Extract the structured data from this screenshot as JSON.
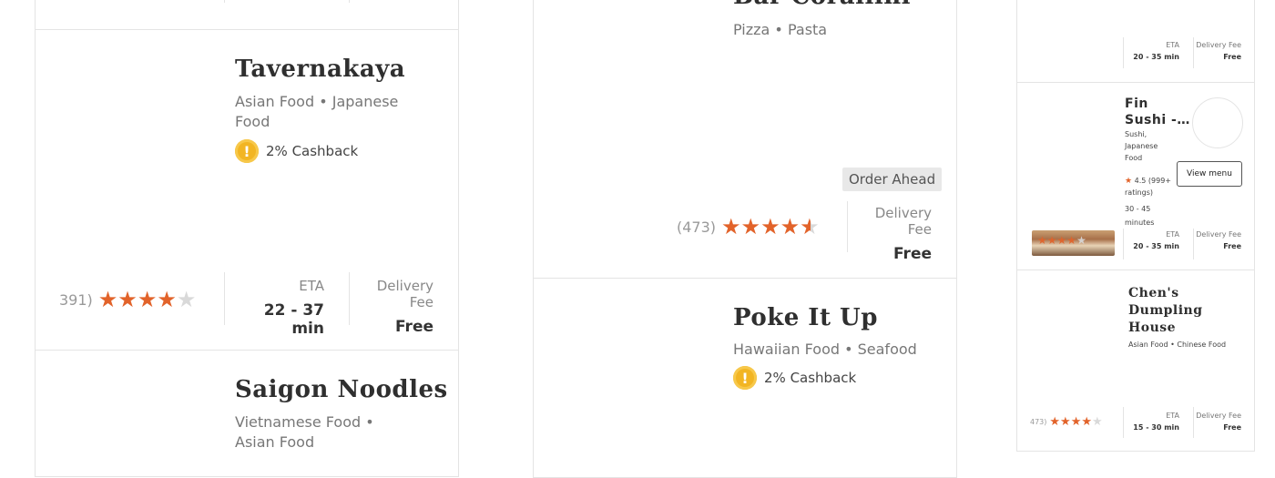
{
  "left_column": {
    "top_card": {},
    "tavernakaya": {
      "name": "Tavernakaya",
      "cuisine": "Asian Food • Japanese Food",
      "cashback": "2% Cashback",
      "coin_glyph": "!",
      "rating_count": "391)",
      "stars": 4,
      "eta_label": "ETA",
      "eta_value": "22 - 37 min",
      "fee_label": "Delivery Fee",
      "fee_value": "Free"
    },
    "saigon": {
      "name": "Saigon Noodles",
      "cuisine": "Vietnamese Food • Asian Food"
    }
  },
  "middle_column": {
    "bar": {
      "name": "Bar Corallini",
      "cuisine": "Pizza • Pasta",
      "badge": "Order Ahead",
      "rating_count": "(473)",
      "stars": 4.5,
      "fee_label": "Delivery Fee",
      "fee_value": "Free"
    },
    "poke": {
      "name": "Poke It Up",
      "cuisine": "Hawaiian Food • Seafood",
      "cashback": "2% Cashback",
      "coin_glyph": "!"
    }
  },
  "right_column": {
    "top_card": {
      "eta_label": "ETA",
      "eta_value": "20 - 35 min",
      "fee_label": "Delivery Fee",
      "fee_value": "Free"
    },
    "fin_sushi": {
      "name_line1": "Fin",
      "name_line2": "Sushi -…",
      "cuisine_line1": "Sushi,",
      "cuisine_line2": "Japanese",
      "cuisine_line3": "Food",
      "rating_line1": "4.5 (999+",
      "rating_line2": "ratings)",
      "time_line1": "30 - 45",
      "time_line2": "minutes",
      "view_menu": "View menu",
      "eta_label": "ETA",
      "eta_value": "20 - 35 min",
      "fee_label": "Delivery Fee",
      "fee_value": "Free",
      "star_glyph": "★"
    },
    "chens": {
      "name_line1": "Chen's",
      "name_line2": "Dumpling",
      "name_line3": "House",
      "cuisine": "Asian Food • Chinese Food",
      "rating_count": "473)",
      "stars": 4,
      "eta_label": "ETA",
      "eta_value": "15 - 30 min",
      "fee_label": "Delivery Fee",
      "fee_value": "Free"
    }
  },
  "colors": {
    "star": "#e2632a",
    "coin": "#f2b523",
    "badge_bg": "#e8e8e8"
  },
  "icons": {
    "star": "star-icon",
    "cashback": "cashback-coin-icon"
  }
}
